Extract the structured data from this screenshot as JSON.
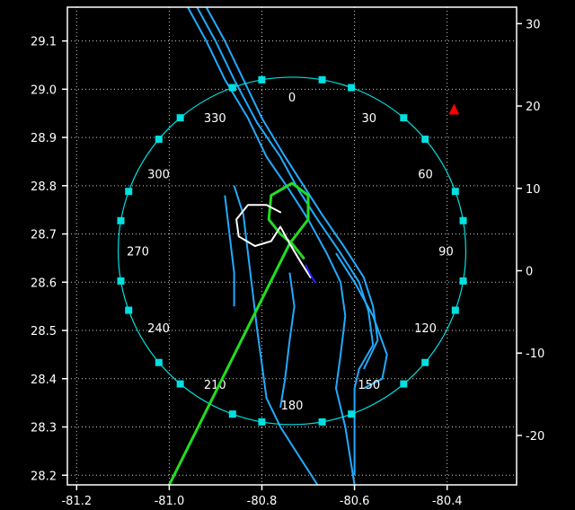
{
  "colors": {
    "background": "#000000",
    "axes": "#ffffff",
    "grid": "#ffffff",
    "coastline": "#22aaff",
    "range_ring": "#00e0e0",
    "green_track": "#22dd22",
    "white_track": "#ffffff",
    "blue_track": "#2222ff",
    "marker": "#ff0000"
  },
  "chart_data": {
    "type": "scatter",
    "title": "",
    "xlabel": "",
    "ylabel": "",
    "x_ticks": [
      "-81.2",
      "-81.0",
      "-80.8",
      "-80.6",
      "-80.4"
    ],
    "y_left_ticks": [
      "29.1",
      "29.0",
      "28.9",
      "28.8",
      "28.7",
      "28.6",
      "28.5",
      "28.4",
      "28.3",
      "28.2"
    ],
    "y_right_ticks": [
      "30",
      "20",
      "10",
      "0",
      "-10",
      "-20"
    ],
    "xlim": [
      -81.22,
      -80.25
    ],
    "ylim": [
      28.18,
      29.17
    ],
    "y_right_lim": [
      -26,
      32
    ],
    "grid": true,
    "range_ring": {
      "center": [
        -80.735,
        28.665
      ],
      "radius_deg": 0.36,
      "bearing_labels": [
        "0",
        "30",
        "60",
        "90",
        "120",
        "150",
        "180",
        "210",
        "240",
        "270",
        "300",
        "330"
      ]
    },
    "marker": {
      "lon": -80.385,
      "lat": 28.955,
      "shape": "triangle"
    },
    "tracks": {
      "green": [
        [
          -81.0,
          28.18
        ],
        [
          -80.74,
          28.68
        ],
        [
          -80.7,
          28.73
        ],
        [
          -80.7,
          28.78
        ],
        [
          -80.735,
          28.805
        ],
        [
          -80.78,
          28.78
        ],
        [
          -80.785,
          28.73
        ],
        [
          -80.76,
          28.7
        ],
        [
          -80.735,
          28.68
        ],
        [
          -80.71,
          28.65
        ]
      ],
      "white": [
        [
          -80.76,
          28.745
        ],
        [
          -80.79,
          28.76
        ],
        [
          -80.83,
          28.76
        ],
        [
          -80.855,
          28.73
        ],
        [
          -80.85,
          28.695
        ],
        [
          -80.815,
          28.675
        ],
        [
          -80.78,
          28.685
        ],
        [
          -80.76,
          28.715
        ],
        [
          -80.74,
          28.68
        ],
        [
          -80.715,
          28.64
        ],
        [
          -80.695,
          28.61
        ]
      ],
      "blue": [
        [
          -80.705,
          28.635
        ],
        [
          -80.695,
          28.615
        ],
        [
          -80.685,
          28.6
        ]
      ]
    }
  }
}
